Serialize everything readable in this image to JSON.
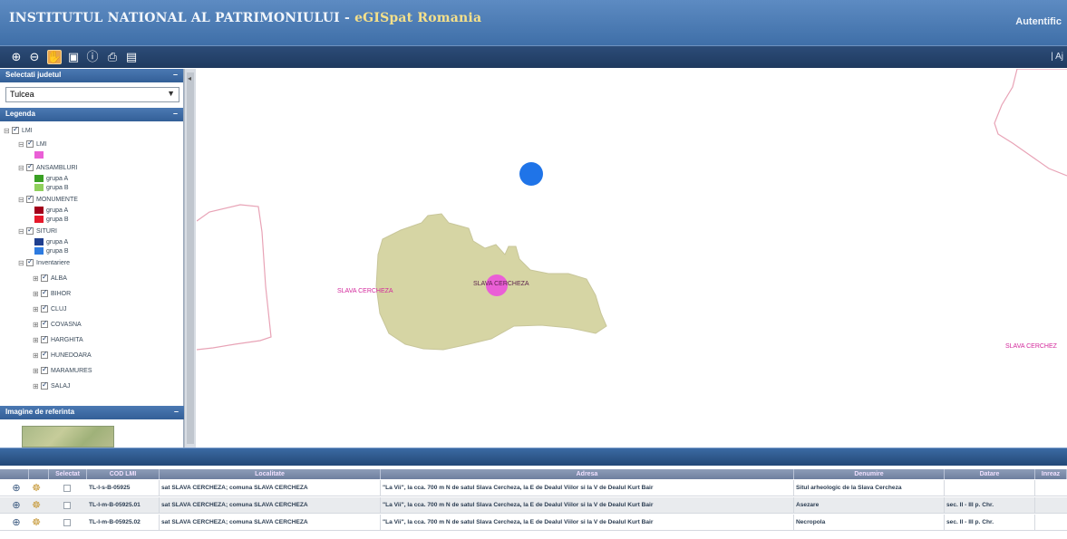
{
  "header": {
    "title_main": "INSTITUTUL NATIONAL AL PATRIMONIULUI - ",
    "title_accent": "eGISpat Romania",
    "right_link": "Autentific"
  },
  "toolbar": {
    "buttons": [
      {
        "icon": "zoom-in-icon",
        "glyph": "⊕"
      },
      {
        "icon": "zoom-out-icon",
        "glyph": "⊖"
      },
      {
        "icon": "pan-hand-icon",
        "glyph": "✋"
      },
      {
        "icon": "zoom-extent-icon",
        "glyph": "▣"
      },
      {
        "icon": "info-icon",
        "glyph": "ⓘ"
      },
      {
        "icon": "print-icon",
        "glyph": "⎙"
      },
      {
        "icon": "export-icon",
        "glyph": "▤"
      }
    ],
    "right_link": "| Aj"
  },
  "sidebar": {
    "county_panel": {
      "title": "Selectati judetul",
      "collapse": "–",
      "selected": "Tulcea"
    },
    "legend_panel": {
      "title": "Legenda",
      "collapse": "–",
      "items": [
        {
          "label": "LMI"
        },
        {
          "label": "LMI"
        },
        {
          "label": "ANSAMBLURI"
        },
        {
          "label": "grupa A",
          "color": "#3aa024"
        },
        {
          "label": "grupa B",
          "color": "#8fd05c"
        },
        {
          "label": "MONUMENTE"
        },
        {
          "label": "grupa A",
          "color": "#a3001a"
        },
        {
          "label": "grupa B",
          "color": "#e6192b"
        },
        {
          "label": "SITURI"
        },
        {
          "label": "grupa A",
          "color": "#1f3f8f"
        },
        {
          "label": "grupa B",
          "color": "#2e7be0"
        },
        {
          "label": "Inventariere"
        },
        {
          "label": "ALBA"
        },
        {
          "label": "BIHOR"
        },
        {
          "label": "CLUJ"
        },
        {
          "label": "COVASNA"
        },
        {
          "label": "HARGHITA"
        },
        {
          "label": "HUNEDOARA"
        },
        {
          "label": "MARAMURES"
        },
        {
          "label": "SALAJ"
        }
      ],
      "lmi_color": "#ea5fd6"
    },
    "image_panel": {
      "title": "Imagine de referinta",
      "collapse": "–"
    }
  },
  "map": {
    "labels": [
      {
        "text": "SLAVA CERCHEZA"
      },
      {
        "text": "SLAVA CERCHEZA"
      },
      {
        "text": "SLAVA CERCHEZ"
      }
    ]
  },
  "grid": {
    "columns": [
      "",
      "",
      "Selectat",
      "COD LMI",
      "Localitate",
      "Adresa",
      "Denumire",
      "Datare",
      "Inreaz"
    ],
    "rows": [
      {
        "cod": "TL-I-s-B-05925",
        "localitate": "sat SLAVA CERCHEZA; comuna SLAVA CERCHEZA",
        "adresa": "\"La Vii\", la cca. 700 m N de satul Slava Cercheza, la E de Dealul Viilor si la V de Dealul Kurt Bair",
        "denumire": "Situl arheologic de la Slava Cercheza",
        "datare": ""
      },
      {
        "cod": "TL-I-m-B-05925.01",
        "localitate": "sat SLAVA CERCHEZA; comuna SLAVA CERCHEZA",
        "adresa": "\"La Vii\", la cca. 700 m N de satul Slava Cercheza, la E de Dealul Viilor si la V de Dealul Kurt Bair",
        "denumire": "Asezare",
        "datare": "sec. II - III p. Chr."
      },
      {
        "cod": "TL-I-m-B-05925.02",
        "localitate": "sat SLAVA CERCHEZA; comuna SLAVA CERCHEZA",
        "adresa": "\"La Vii\", la cca. 700 m N de satul Slava Cercheza, la E de Dealul Viilor si la V de Dealul Kurt Bair",
        "denumire": "Necropola",
        "datare": "sec. II - III p. Chr."
      }
    ]
  }
}
